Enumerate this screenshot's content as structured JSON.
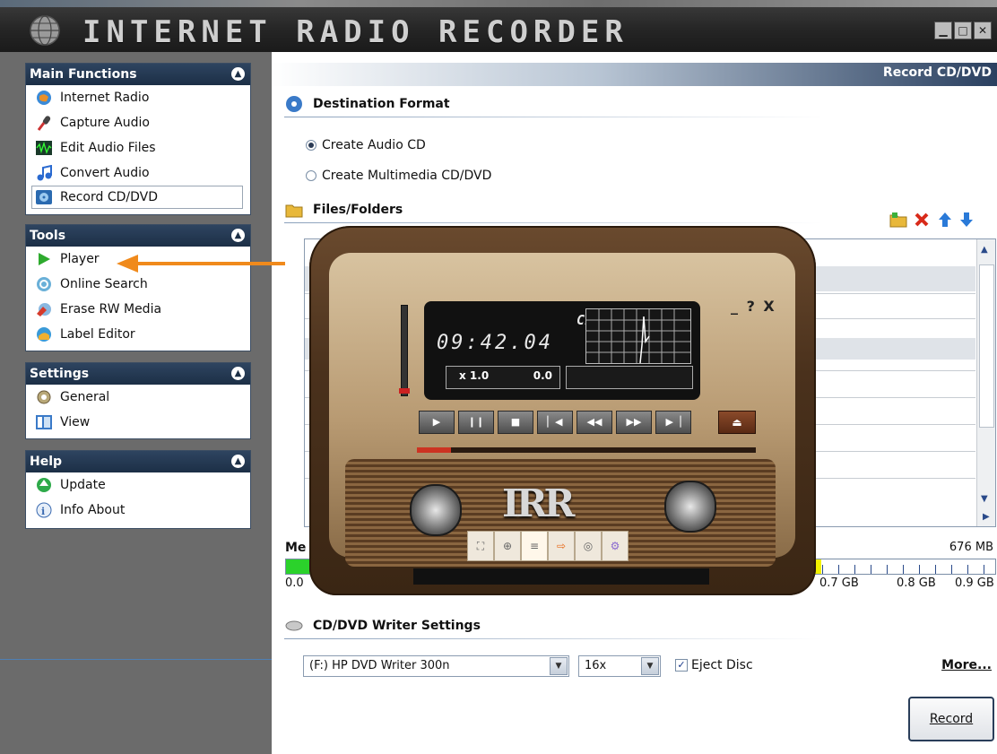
{
  "app": {
    "title": "INTERNET RADIO RECORDER",
    "window_buttons": [
      "▁",
      "□",
      "✕"
    ]
  },
  "sidebar": {
    "main_functions": {
      "title": "Main Functions",
      "items": [
        {
          "label": "Internet Radio",
          "icon": "globe-icon"
        },
        {
          "label": "Capture Audio",
          "icon": "microphone-icon"
        },
        {
          "label": "Edit Audio Files",
          "icon": "waveform-icon"
        },
        {
          "label": "Convert Audio",
          "icon": "music-note-icon"
        },
        {
          "label": "Record CD/DVD",
          "icon": "disc-burn-icon",
          "selected": true
        }
      ]
    },
    "tools": {
      "title": "Tools",
      "items": [
        {
          "label": "Player",
          "icon": "play-icon"
        },
        {
          "label": "Online Search",
          "icon": "search-globe-icon"
        },
        {
          "label": "Erase RW Media",
          "icon": "erase-disc-icon"
        },
        {
          "label": "Label Editor",
          "icon": "label-icon"
        }
      ]
    },
    "settings": {
      "title": "Settings",
      "items": [
        {
          "label": "General",
          "icon": "gear-icon"
        },
        {
          "label": "View",
          "icon": "view-icon"
        }
      ]
    },
    "help": {
      "title": "Help",
      "items": [
        {
          "label": "Update",
          "icon": "update-icon"
        },
        {
          "label": "Info About",
          "icon": "info-icon"
        }
      ]
    }
  },
  "main": {
    "header": "Record CD/DVD",
    "destination": {
      "title": "Destination Format",
      "options": [
        "Create Audio CD",
        "Create Multimedia CD/DVD"
      ],
      "selected": "Create Audio CD"
    },
    "files": {
      "title": "Files/Folders"
    },
    "media": {
      "label": "Me",
      "size": "676 MB",
      "gb_left": "0.0",
      "gb_ticks": [
        "0.7 GB",
        "0.8 GB",
        "0.9 GB"
      ]
    },
    "writer": {
      "title": "CD/DVD Writer Settings",
      "drive": "(F:) HP DVD Writer 300n",
      "speed": "16x",
      "eject_label": "Eject Disc",
      "eject_checked": true,
      "more_label": "More...",
      "record_label": "Record"
    }
  },
  "player": {
    "clock_label": "CLOCK",
    "time": "09:42.04",
    "speed": "x 1.0",
    "position": "0.0",
    "window_controls": "_ ? X",
    "logo": "IRR",
    "transport": [
      "▶",
      "❙❙",
      "■",
      "▏◀",
      "◀◀",
      "▶▶",
      "▶▕"
    ],
    "eject": "⏏",
    "progress": 0.1,
    "toolbar": [
      "⛶",
      "⊕",
      "≡",
      "⇨",
      "◎",
      "⚙"
    ]
  },
  "colors": {
    "accent_dark": "#1c2f46",
    "arrow_orange": "#f08a1c",
    "media_green": "#2bd22b",
    "media_yellow": "#f2f200"
  }
}
